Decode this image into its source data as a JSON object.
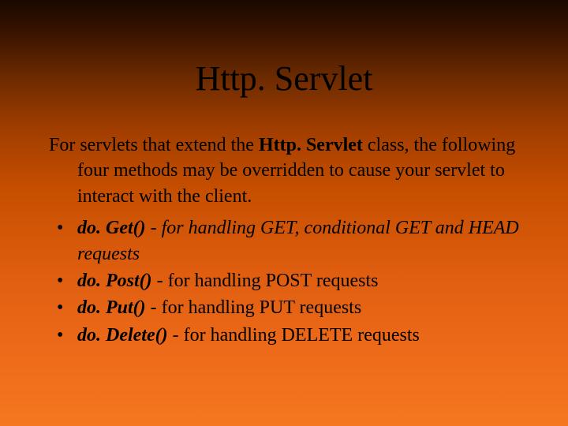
{
  "slide": {
    "title": "Http. Servlet",
    "intro_before": "For servlets that extend the ",
    "intro_bold": "Http. Servlet",
    "intro_after": " class, the following four methods may be overridden to cause your servlet to interact with the client.",
    "bullets": [
      {
        "method": "do. Get()",
        "desc_plain": " - ",
        "desc_it": "for handling GET, conditional GET and HEAD requests"
      },
      {
        "method": "do. Post()",
        "desc_plain": " - for handling POST requests",
        "desc_it": ""
      },
      {
        "method": "do. Put()",
        "desc_plain": " - for handling PUT requests",
        "desc_it": ""
      },
      {
        "method": "do. Delete()",
        "desc_plain": " - for handling DELETE requests",
        "desc_it": ""
      }
    ]
  }
}
